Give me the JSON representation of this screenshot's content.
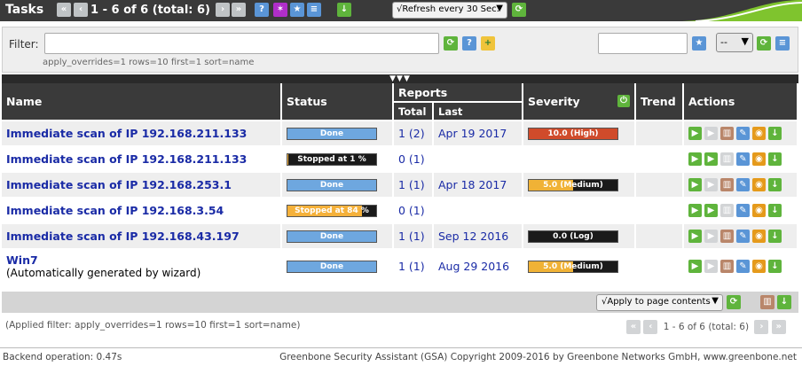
{
  "titlebar": {
    "title": "Tasks",
    "pager": "1 - 6 of 6 (total: 6)",
    "refresh": "√Refresh every 30 Sec."
  },
  "filter": {
    "label": "Filter:",
    "value": "",
    "subtext": "apply_overrides=1 rows=10 first=1 sort=name",
    "select_value": "--"
  },
  "divider": "▼▼▼",
  "table": {
    "headers": {
      "name": "Name",
      "status": "Status",
      "reports": "Reports",
      "total": "Total",
      "last": "Last",
      "severity": "Severity",
      "trend": "Trend",
      "actions": "Actions"
    },
    "rows": [
      {
        "name": "Immediate scan of IP 192.168.211.133",
        "comment": "",
        "status": "Done",
        "status_color": "#6ea7df",
        "status_fill": 100,
        "total": "1 (2)",
        "last": "Apr 19 2017",
        "severity": "10.0 (High)",
        "sev_color": "#d04b2b",
        "sev_fill": 100
      },
      {
        "name": "Immediate scan of IP 192.168.211.133",
        "comment": "",
        "status": "Stopped at 1 %",
        "status_color": "#f5b13a",
        "status_fill": 1,
        "total": "0 (1)",
        "last": "",
        "severity": "",
        "sev_color": "",
        "sev_fill": 0
      },
      {
        "name": "Immediate scan of IP 192.168.253.1",
        "comment": "",
        "status": "Done",
        "status_color": "#6ea7df",
        "status_fill": 100,
        "total": "1 (1)",
        "last": "Apr 18 2017",
        "severity": "5.0 (Medium)",
        "sev_color": "#f0b236",
        "sev_fill": 50
      },
      {
        "name": "Immediate scan of IP 192.168.3.54",
        "comment": "",
        "status": "Stopped at 84 %",
        "status_color": "#f5b13a",
        "status_fill": 84,
        "total": "0 (1)",
        "last": "",
        "severity": "",
        "sev_color": "",
        "sev_fill": 0
      },
      {
        "name": "Immediate scan of IP 192.168.43.197",
        "comment": "",
        "status": "Done",
        "status_color": "#6ea7df",
        "status_fill": 100,
        "total": "1 (1)",
        "last": "Sep 12 2016",
        "severity": "0.0 (Log)",
        "sev_color": "#1a1a1a",
        "sev_fill": 0
      },
      {
        "name": "Win7",
        "comment": "(Automatically generated by wizard)",
        "status": "Done",
        "status_color": "#6ea7df",
        "status_fill": 100,
        "total": "1 (1)",
        "last": "Aug 29 2016",
        "severity": "5.0 (Medium)",
        "sev_color": "#f0b236",
        "sev_fill": 50
      }
    ]
  },
  "table_footer": {
    "apply": "√Apply to page contents"
  },
  "applied_filter": "(Applied filter: apply_overrides=1 rows=10 first=1 sort=name)",
  "bottom_pager": "1 - 6 of 6 (total: 6)",
  "footer": {
    "left": "Backend operation: 0.47s",
    "right": "Greenbone Security Assistant (GSA) Copyright 2009-2016 by Greenbone Networks GmbH, www.greenbone.net"
  }
}
